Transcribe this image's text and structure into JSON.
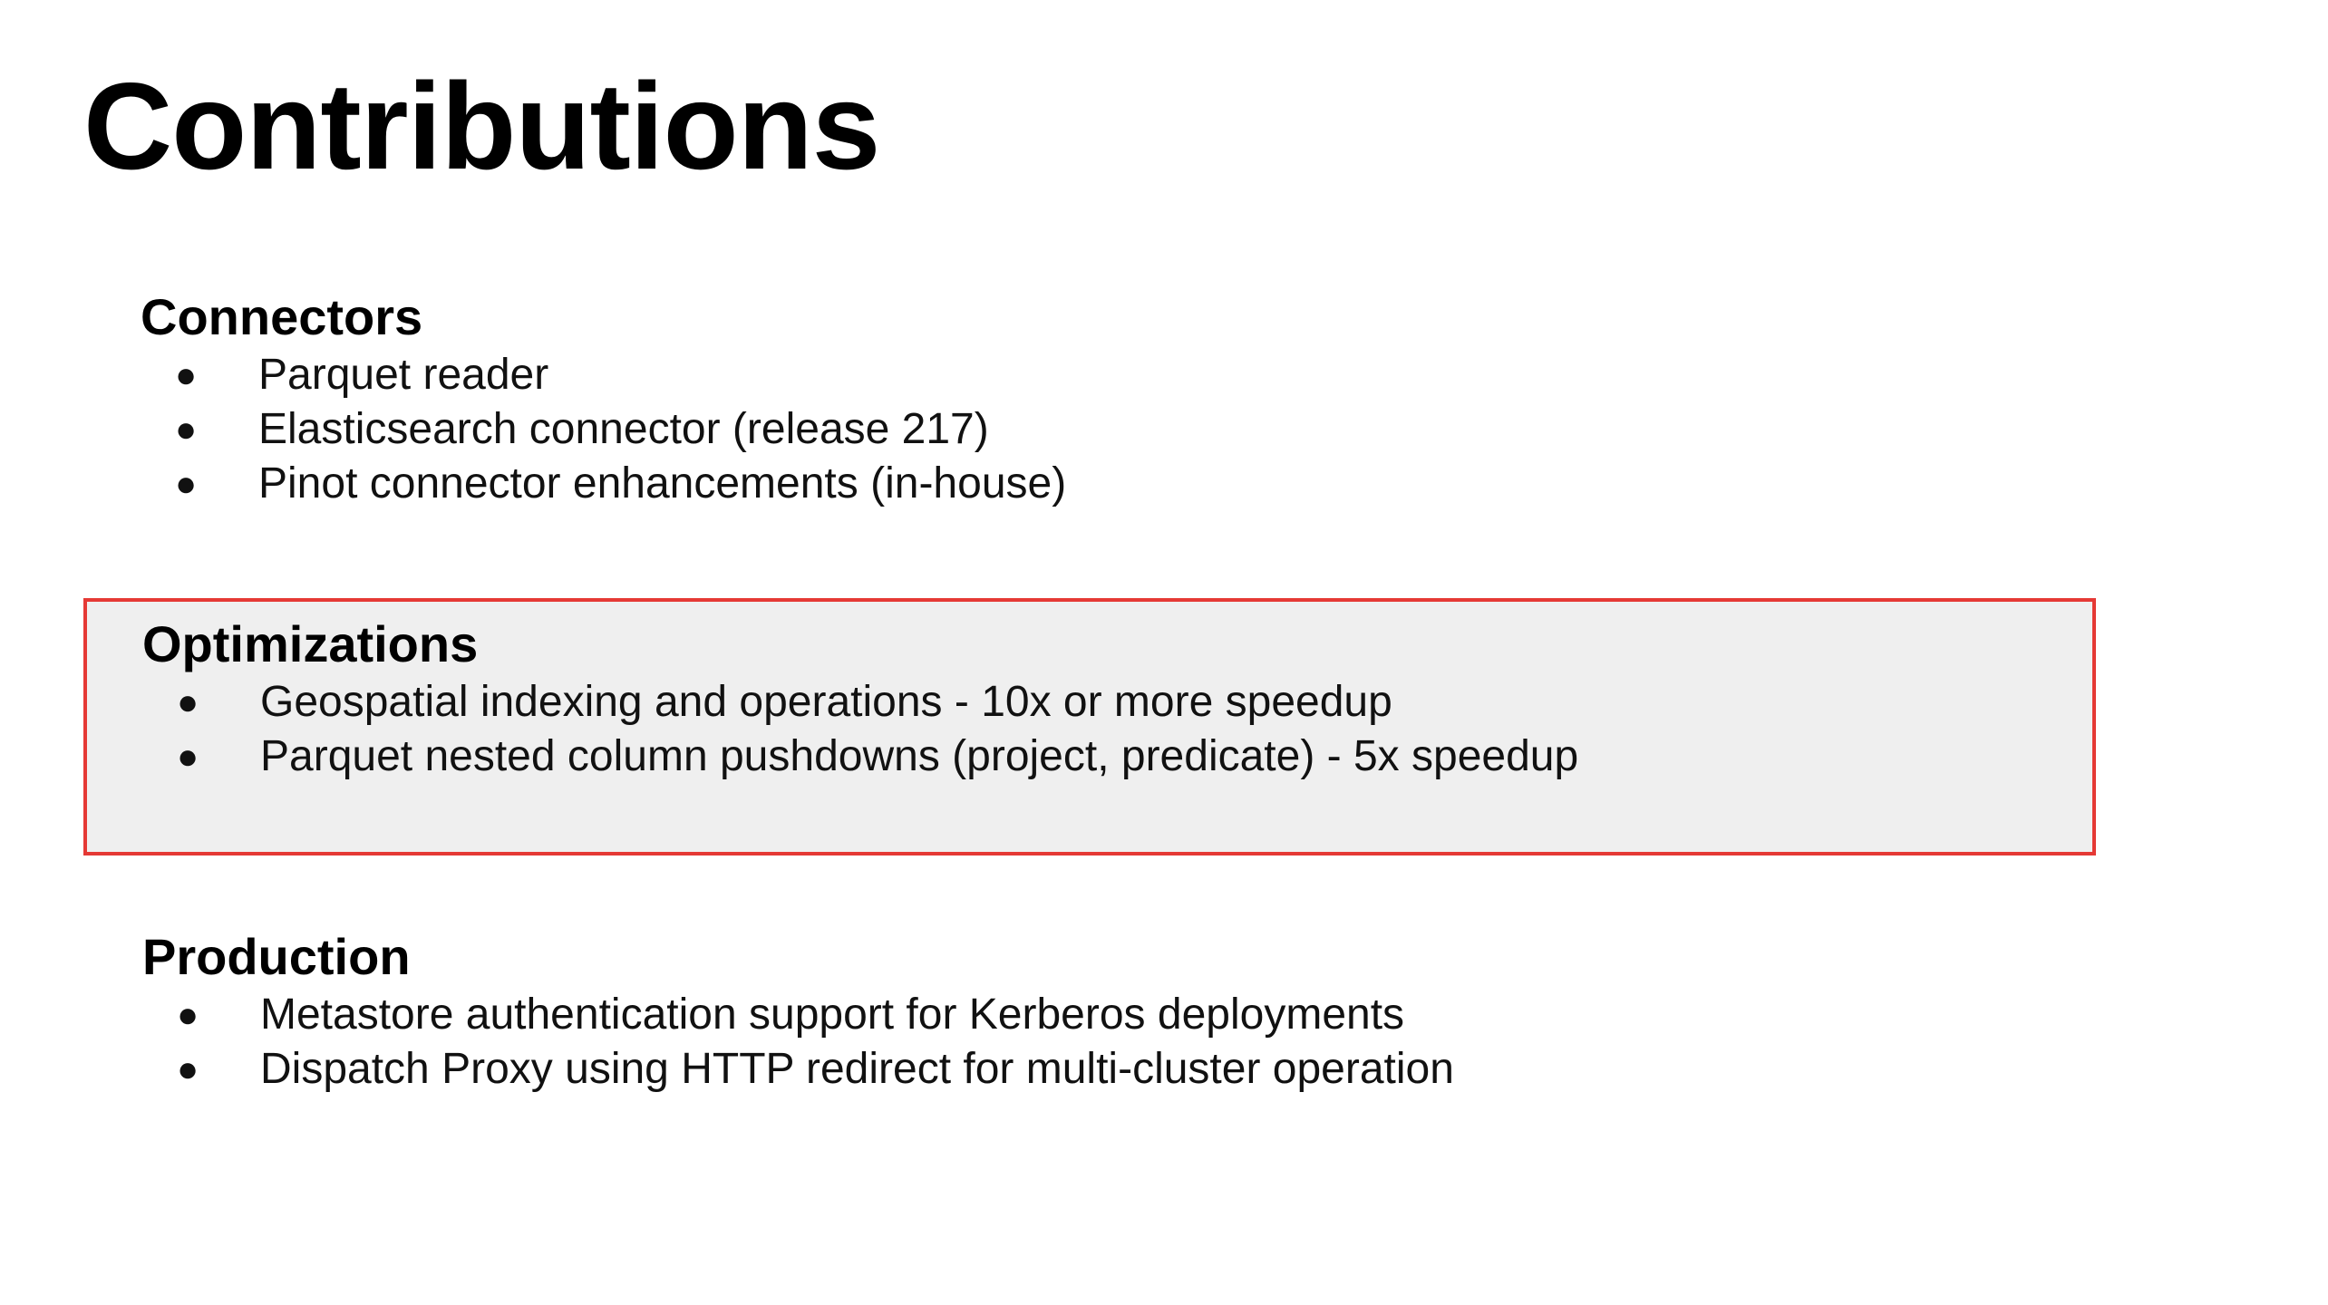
{
  "slide": {
    "title": "Contributions",
    "highlight_color": "#e53935",
    "highlight_fill": "#efefef"
  },
  "sections": [
    {
      "heading": "Connectors",
      "highlighted": false,
      "items": [
        "Parquet reader",
        "Elasticsearch connector (release 217)",
        "Pinot connector enhancements (in-house)"
      ]
    },
    {
      "heading": "Optimizations",
      "highlighted": true,
      "items": [
        "Geospatial indexing and operations - 10x or more speedup",
        "Parquet nested column pushdowns (project, predicate) - 5x speedup"
      ]
    },
    {
      "heading": "Production",
      "highlighted": false,
      "items": [
        "Metastore authentication support for Kerberos deployments",
        "Dispatch Proxy using HTTP redirect for multi-cluster operation"
      ]
    }
  ],
  "bullet_glyph": "●"
}
